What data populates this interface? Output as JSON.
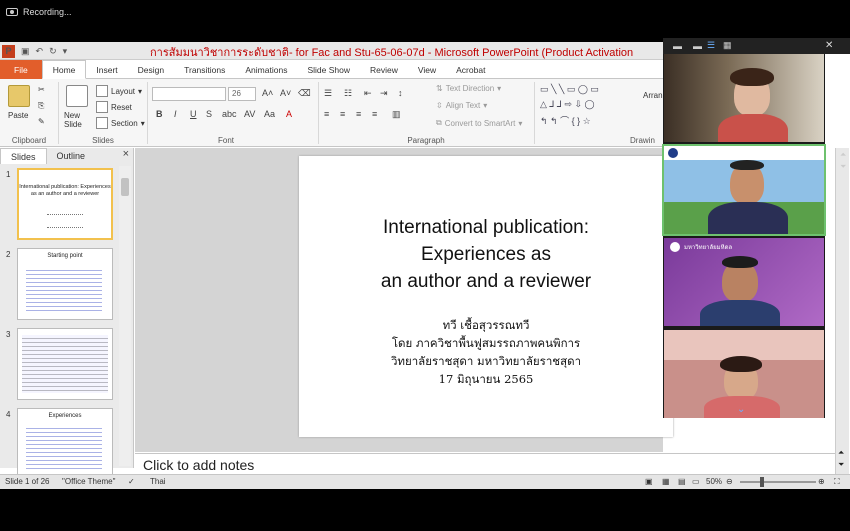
{
  "recording": {
    "label": "Recording..."
  },
  "window": {
    "title": "การสัมมนาวิชาการระดับชาติ- for Fac and Stu-65-06-07d  -  Microsoft PowerPoint (Product Activation",
    "app_icon_letter": "P"
  },
  "ribbon_tabs": [
    "File",
    "Home",
    "Insert",
    "Design",
    "Transitions",
    "Animations",
    "Slide Show",
    "Review",
    "View",
    "Acrobat"
  ],
  "ribbon": {
    "clipboard": {
      "paste": "Paste",
      "group": "Clipboard"
    },
    "slides": {
      "new_slide": "New Slide",
      "layout": "Layout",
      "reset": "Reset",
      "section": "Section",
      "group": "Slides"
    },
    "font": {
      "font_size": "26",
      "group": "Font"
    },
    "paragraph": {
      "text_direction": "Text Direction",
      "align_text": "Align Text",
      "smartart": "Convert to SmartArt",
      "group": "Paragraph"
    },
    "drawing": {
      "group": "Drawin",
      "arrange": "Arran"
    }
  },
  "panel": {
    "tab_slides": "Slides",
    "tab_outline": "Outline",
    "close": "×"
  },
  "thumbnails": [
    {
      "num": "1",
      "title": "International publication: Experiences as an author and a reviewer"
    },
    {
      "num": "2",
      "title": "Starting point"
    },
    {
      "num": "3",
      "title": ""
    },
    {
      "num": "4",
      "title": "Experiences"
    }
  ],
  "slide": {
    "title_lines": [
      "International publication:",
      "Experiences as",
      "an author and a reviewer"
    ],
    "body_lines": [
      "ทวี  เชื้อสุวรรณทวี",
      "โดย ภาควิชาพื้นฟูสมรรถภาพคนพิการ",
      "วิทยาลัยราชสุดา มหาวิทยาลัยราชสุดา",
      "17 มิถุนายน 2565"
    ]
  },
  "notes_placeholder": "Click to add notes",
  "status": {
    "slide_of": "Slide 1 of 26",
    "theme": "\"Office Theme\"",
    "language": "Thai",
    "zoom": "50%"
  },
  "video": {
    "tiles": [
      {
        "name": "participant-1",
        "label": ""
      },
      {
        "name": "participant-2",
        "label": ""
      },
      {
        "name": "participant-3",
        "label": "มหาวิทยาลัยมหิดล"
      },
      {
        "name": "participant-4",
        "label": ""
      }
    ]
  }
}
